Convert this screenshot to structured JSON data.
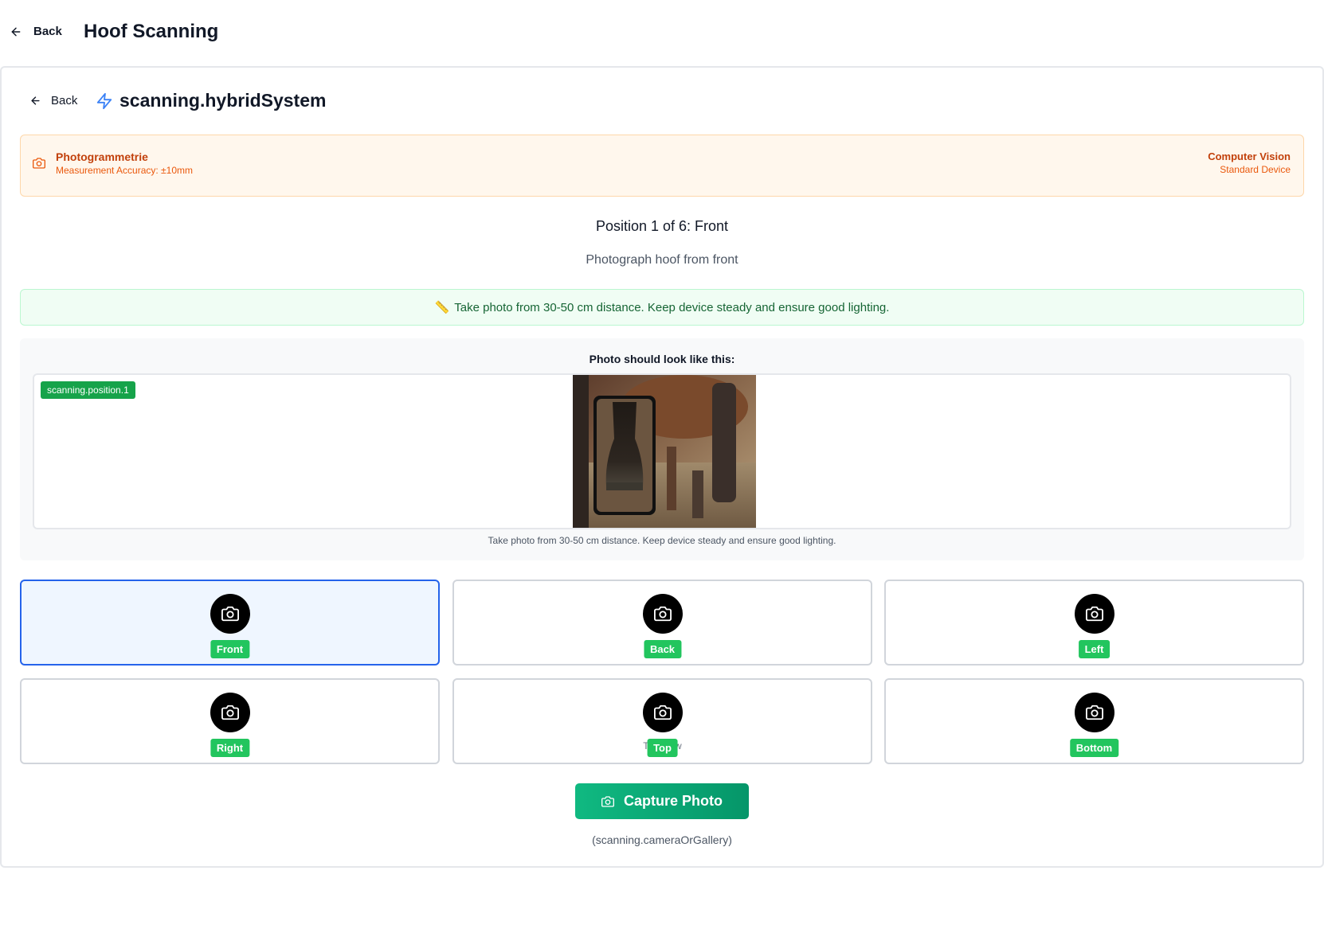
{
  "header": {
    "back_label": "Back",
    "title": "Hoof Scanning"
  },
  "inner_header": {
    "back_label": "Back",
    "title": "scanning.hybridSystem",
    "accent_color": "#3b82f6"
  },
  "method": {
    "name": "Photogrammetrie",
    "accuracy": "Measurement Accuracy: ±10mm",
    "technology": "Computer Vision",
    "device": "Standard Device",
    "color": "#c2410c"
  },
  "position": {
    "title": "Position 1 of 6: Front",
    "description": "Photograph hoof from front"
  },
  "tip": {
    "icon": "📏",
    "text": "Take photo from 30-50 cm distance. Keep device steady and ensure good lighting."
  },
  "example": {
    "label": "Photo should look like this:",
    "badge": "scanning.position.1",
    "caption": "Take photo from 30-50 cm distance. Keep device steady and ensure good lighting."
  },
  "positions": [
    {
      "label": "Front",
      "selected": true
    },
    {
      "label": "Back",
      "selected": false
    },
    {
      "label": "Left",
      "selected": false
    },
    {
      "label": "Right",
      "selected": false
    },
    {
      "label": "Top",
      "subtext": "Top View",
      "selected": false
    },
    {
      "label": "Bottom",
      "selected": false
    }
  ],
  "capture": {
    "label": "Capture Photo",
    "hint": "(scanning.cameraOrGallery)"
  },
  "colors": {
    "badge_green": "#22c55e",
    "selected_border": "#2563eb",
    "capture_green": "#10b981"
  }
}
